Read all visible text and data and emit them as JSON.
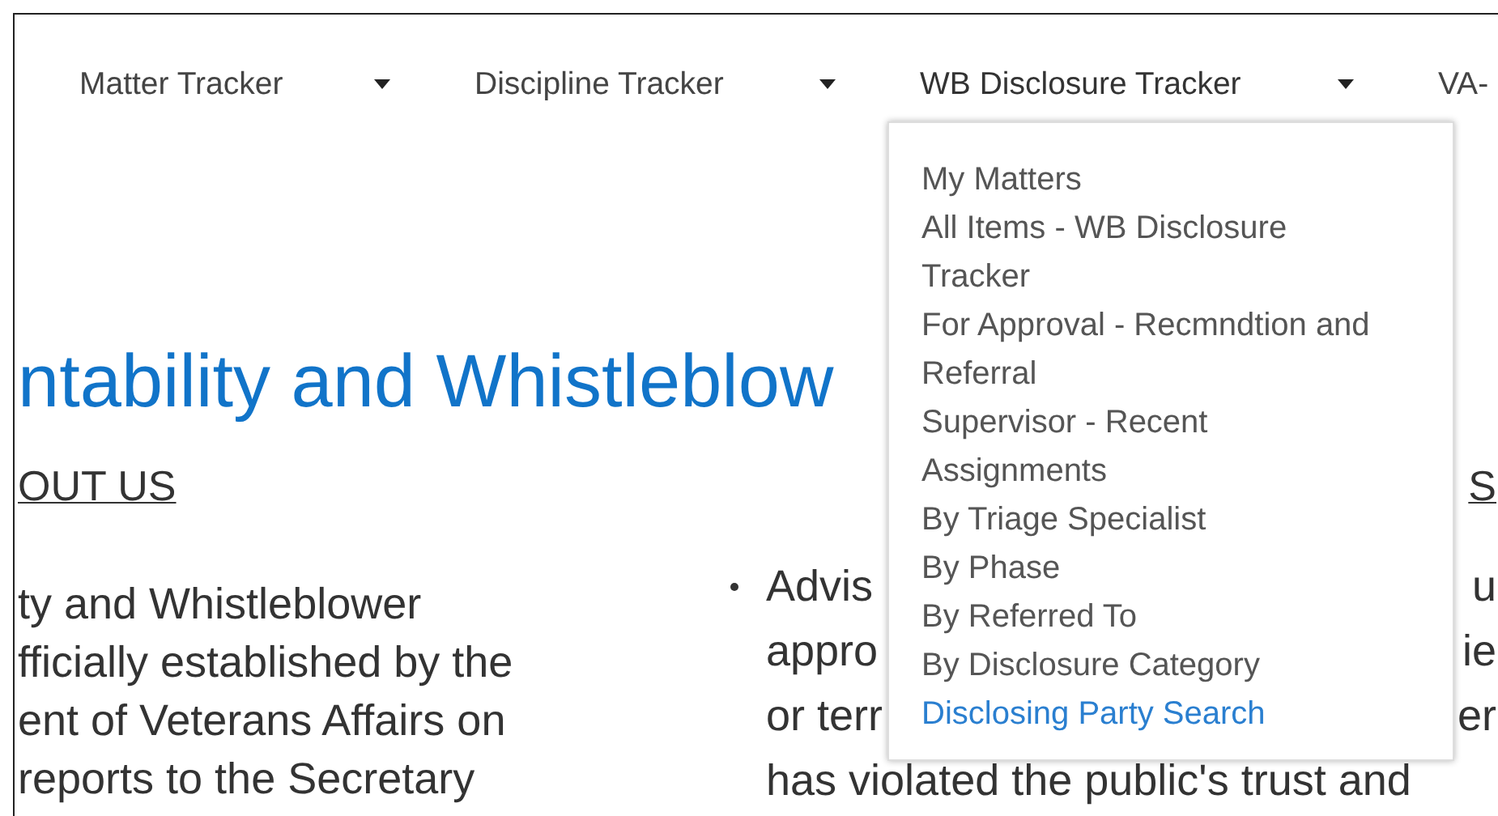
{
  "nav": [
    {
      "label": "Matter Tracker",
      "caret": true,
      "expanded": false
    },
    {
      "label": "Discipline Tracker",
      "caret": true,
      "expanded": false
    },
    {
      "label": "WB Disclosure Tracker",
      "caret": true,
      "expanded": true
    },
    {
      "label": "VA-",
      "caret": false,
      "expanded": false
    }
  ],
  "menu": [
    {
      "label": "My Matters",
      "kind": "item"
    },
    {
      "label": "All Items - WB Disclosure Tracker",
      "kind": "item"
    },
    {
      "label": "For Approval - Recmndtion and Referral",
      "kind": "item"
    },
    {
      "label": "Supervisor - Recent Assignments",
      "kind": "item"
    },
    {
      "label": "By Triage Specialist",
      "kind": "item"
    },
    {
      "label": "By Phase",
      "kind": "item"
    },
    {
      "label": "By Referred To",
      "kind": "item"
    },
    {
      "label": "By Disclosure Category",
      "kind": "item"
    },
    {
      "label": "Disclosing Party Search",
      "kind": "link"
    }
  ],
  "page_title": "ntability and Whistleblow",
  "headings": [
    "OUT US",
    "S"
  ],
  "left_paragraph": [
    "ty and Whistleblower",
    "fficially established by the",
    "ent of Veterans Affairs on",
    "reports to the Secretary"
  ],
  "right_lines": [
    {
      "text": "Advis",
      "tail": "u",
      "bullet": true
    },
    {
      "text": "appro",
      "tail": "ie",
      "bullet": false
    },
    {
      "text": "or terr",
      "tail": "er",
      "bullet": false
    },
    {
      "text": "has violated the public's trust and",
      "bullet": false
    }
  ]
}
